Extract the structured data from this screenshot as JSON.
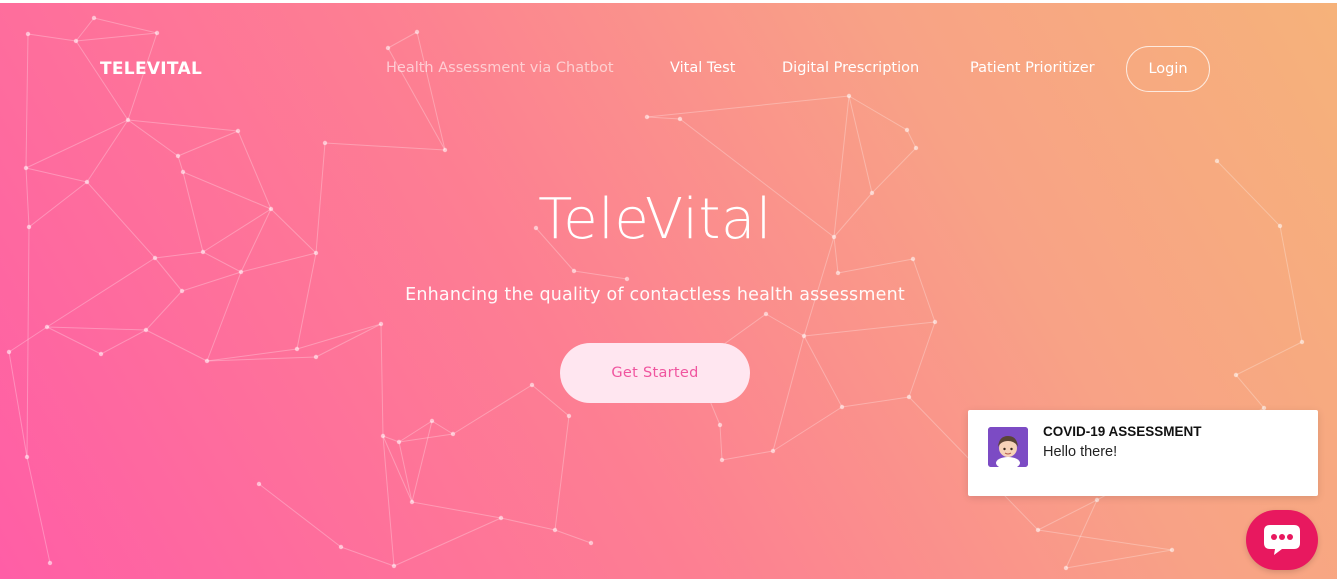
{
  "theme": {
    "gradient_start": "#ff5ea6",
    "gradient_end": "#f6b27a",
    "cta_text_color": "#f0559f",
    "chat_fab_color": "#e8185f",
    "avatar_bg": "#7c4bc4"
  },
  "header": {
    "brand": "TELEVITAL",
    "nav": [
      {
        "label": "Health Assessment via Chatbot",
        "state": "muted"
      },
      {
        "label": "Vital Test",
        "state": "normal"
      },
      {
        "label": "Digital Prescription",
        "state": "normal"
      },
      {
        "label": "Patient Prioritizer",
        "state": "normal"
      }
    ],
    "login_label": "Login"
  },
  "hero": {
    "title": "TeleVital",
    "subtitle": "Enhancing the quality of contactless health assessment",
    "cta_label": "Get Started"
  },
  "chat_widget": {
    "title": "COVID-19 ASSESSMENT",
    "message": "Hello there!",
    "avatar_icon": "bot-avatar-icon",
    "launcher_icon": "chat-bubble-icon"
  }
}
